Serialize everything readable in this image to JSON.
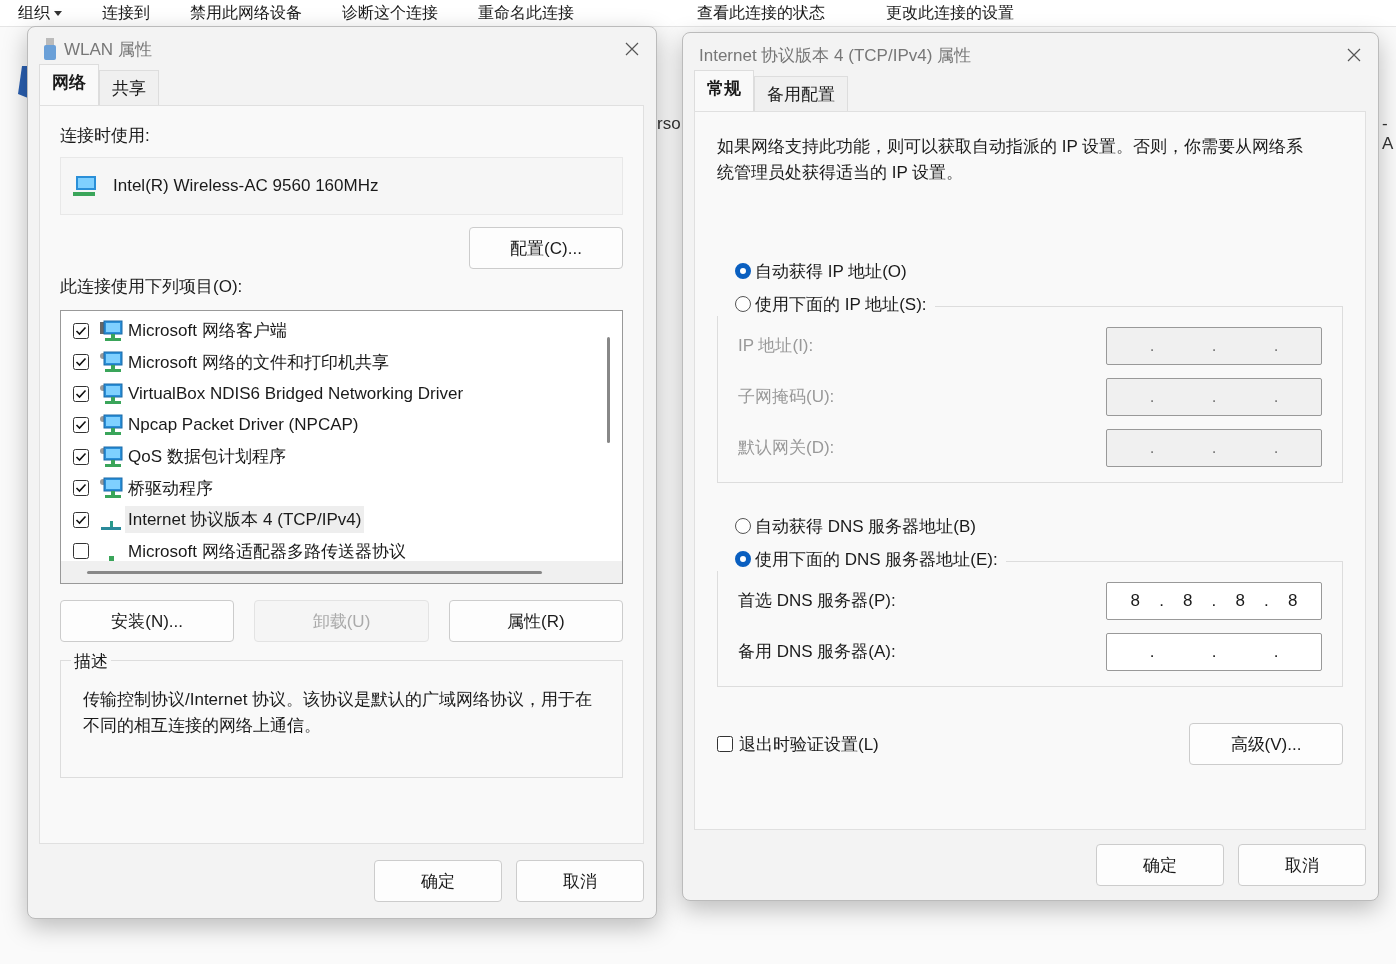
{
  "background": {
    "toolbar": [
      "组织",
      "连接到",
      "禁用此网络设备",
      "诊断这个连接",
      "重命名此连接",
      "查看此连接的状态",
      "更改此连接的设置"
    ],
    "fragments": [
      "rso",
      "-A"
    ]
  },
  "wlan_dialog": {
    "title": "WLAN 属性",
    "tabs": [
      {
        "label": "网络",
        "selected": true
      },
      {
        "label": "共享",
        "selected": false
      }
    ],
    "connect_using_label": "连接时使用:",
    "adapter": "Intel(R) Wireless-AC 9560 160MHz",
    "configure_button": "配置(C)...",
    "items_label": "此连接使用下列项目(O):",
    "items": [
      {
        "label": "Microsoft 网络客户端",
        "checked": true,
        "selected": false,
        "kind": "client"
      },
      {
        "label": "Microsoft 网络的文件和打印机共享",
        "checked": true,
        "selected": false,
        "kind": "service"
      },
      {
        "label": "VirtualBox NDIS6 Bridged Networking Driver",
        "checked": true,
        "selected": false,
        "kind": "service"
      },
      {
        "label": "Npcap Packet Driver (NPCAP)",
        "checked": true,
        "selected": false,
        "kind": "service"
      },
      {
        "label": "QoS 数据包计划程序",
        "checked": true,
        "selected": false,
        "kind": "service"
      },
      {
        "label": "桥驱动程序",
        "checked": true,
        "selected": false,
        "kind": "service"
      },
      {
        "label": "Internet 协议版本 4 (TCP/IPv4)",
        "checked": true,
        "selected": true,
        "kind": "protocol"
      },
      {
        "label": "Microsoft 网络适配器多路传送器协议",
        "checked": false,
        "selected": false,
        "kind": "protocol_small"
      }
    ],
    "buttons": [
      {
        "label": "安装(N)...",
        "disabled": false
      },
      {
        "label": "卸载(U)",
        "disabled": true
      },
      {
        "label": "属性(R)",
        "disabled": false
      }
    ],
    "description_label": "描述",
    "description": "传输控制协议/Internet 协议。该协议是默认的广域网络协议，用于在不同的相互连接的网络上通信。",
    "footer_buttons": [
      "确定",
      "取消"
    ]
  },
  "ipv4_dialog": {
    "title": "Internet 协议版本 4 (TCP/IPv4) 属性",
    "tabs": [
      {
        "label": "常规",
        "selected": true
      },
      {
        "label": "备用配置",
        "selected": false
      }
    ],
    "intro": "如果网络支持此功能，则可以获取自动指派的 IP 设置。否则，你需要从网络系统管理员处获得适当的 IP 设置。",
    "ip_options": [
      {
        "label": "自动获得 IP 地址(O)",
        "selected": true
      },
      {
        "label": "使用下面的 IP 地址(S):",
        "selected": false
      }
    ],
    "ip_fields": [
      {
        "label": "IP 地址(I):",
        "disabled": true,
        "separator": "."
      },
      {
        "label": "子网掩码(U):",
        "disabled": true,
        "separator": "."
      },
      {
        "label": "默认网关(D):",
        "disabled": true,
        "separator": "."
      }
    ],
    "dns_options": [
      {
        "label": "自动获得 DNS 服务器地址(B)",
        "selected": false
      },
      {
        "label": "使用下面的 DNS 服务器地址(E):",
        "selected": true
      }
    ],
    "dns_fields": [
      {
        "label": "首选 DNS 服务器(P):",
        "disabled": false,
        "separator": ".",
        "octets": [
          "8",
          "8",
          "8",
          "8"
        ]
      },
      {
        "label": "备用 DNS 服务器(A):",
        "disabled": false,
        "separator": "."
      }
    ],
    "validate": {
      "label": "退出时验证设置(L)",
      "checked": false
    },
    "advanced_button": "高级(V)...",
    "footer_buttons": [
      "确定",
      "取消"
    ]
  }
}
